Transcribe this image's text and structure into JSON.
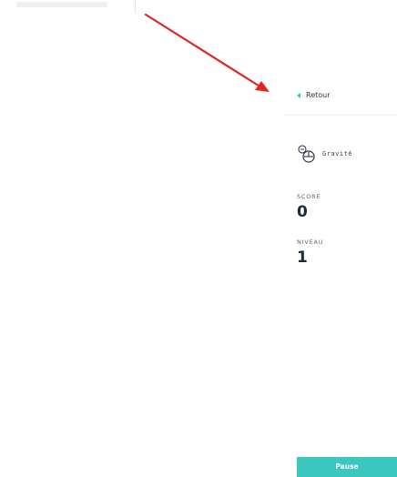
{
  "panel": {
    "back_label": "Retour",
    "mode_label": "Gravité",
    "score_label": "SCORE",
    "score_value": "0",
    "level_label": "NIVEAU",
    "level_value": "1",
    "pause_label": "Pause"
  },
  "colors": {
    "accent": "#3cc6c0",
    "annotation_arrow": "#e02424",
    "text": "#1f2a37"
  },
  "icons": {
    "back": "chevron-left-icon",
    "mode": "gravity-icon"
  }
}
